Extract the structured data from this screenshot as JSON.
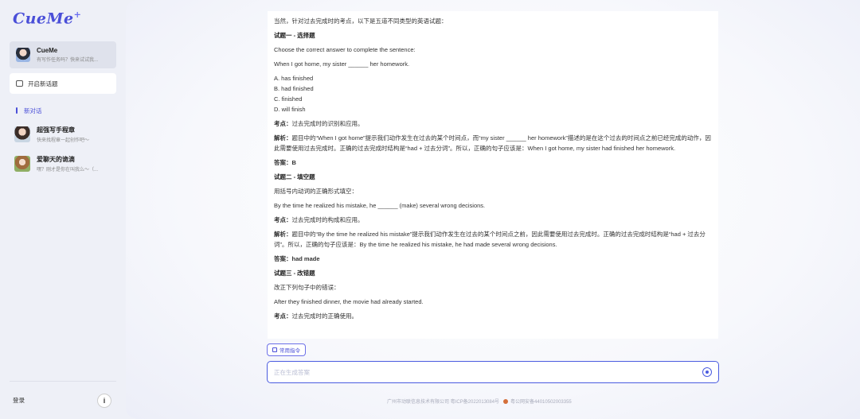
{
  "app": {
    "logo": "CueMe",
    "logo_mark": "+"
  },
  "sidebar": {
    "agent": {
      "title": "CueMe",
      "subtitle": "有写作任务吗？快来试试我..."
    },
    "new_topic": "开启新话题",
    "section": "新对话",
    "conversations": [
      {
        "title": "超强写手程章",
        "subtitle": "快来找程章一起创作吧～"
      },
      {
        "title": "爱聊天的诡滴",
        "subtitle": "嘿？刚才是你在叫我么～（..."
      }
    ],
    "login": "登录",
    "info_icon": "i"
  },
  "chat": {
    "intro": "当然，针对过去完成时的考点，以下是五道不同类型的英语试题：",
    "q1": {
      "title": "试题一 - 选择题",
      "prompt": "Choose the correct answer to complete the sentence:",
      "sentence": "When I got home, my sister ______ her homework.",
      "options": [
        "A. has finished",
        "B. had finished",
        "C. finished",
        "D. will finish"
      ],
      "point_label": "考点：",
      "point": "过去完成时的识别和应用。",
      "analysis_label": "解析：",
      "analysis": "题目中的“When I got home”提示我们动作发生在过去的某个时间点，而“my sister ______ her homework”描述的是在这个过去的时间点之前已经完成的动作，因此需要使用过去完成时。正确的过去完成时结构是“had + 过去分词”。所以，正确的句子应该是：When I got home, my sister had finished her homework.",
      "answer_label": "答案：",
      "answer": "B"
    },
    "q2": {
      "title": "试题二 - 填空题",
      "prompt": "用括号内动词的正确形式填空：",
      "sentence": "By the time he realized his mistake, he ______ (make) several wrong decisions.",
      "point_label": "考点：",
      "point": "过去完成时的构成和应用。",
      "analysis_label": "解析：",
      "analysis": "题目中的“By the time he realized his mistake”提示我们动作发生在过去的某个时间点之前，因此需要使用过去完成时。正确的过去完成时结构是“had + 过去分词”。所以，正确的句子应该是：By the time he realized his mistake, he had made several wrong decisions.",
      "answer_label": "答案：",
      "answer": "had made"
    },
    "q3": {
      "title": "试题三 - 改错题",
      "prompt": "改正下列句子中的错误：",
      "sentence": "After they finished dinner, the movie had already started.",
      "point_label": "考点：",
      "point": "过去完成时的正确使用。"
    },
    "command_button": "常用指令",
    "input_placeholder": "正在生成答案",
    "send_icon": "send-icon"
  },
  "footer": {
    "icp": "广州市动联信息技术有限公司 粤ICP备2022013084号",
    "police": "粤公网安备44010502003355",
    "police_badge_color": "#d46f3a"
  },
  "colors": {
    "accent": "#4a4fd8",
    "input_border": "#4a5be0"
  }
}
